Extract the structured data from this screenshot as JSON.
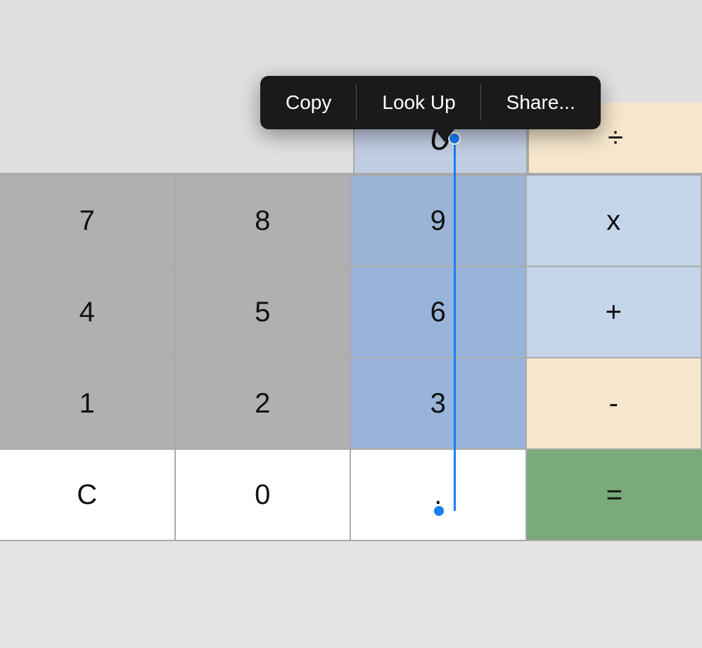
{
  "context_menu": {
    "items": [
      "Copy",
      "Look Up",
      "Share..."
    ]
  },
  "display": {
    "value": "0",
    "operator": "÷"
  },
  "calculator": {
    "rows": [
      [
        {
          "label": "7",
          "type": "gray"
        },
        {
          "label": "8",
          "type": "gray"
        },
        {
          "label": "9",
          "type": "blue-selected"
        },
        {
          "label": "x",
          "type": "blue-light"
        }
      ],
      [
        {
          "label": "4",
          "type": "gray"
        },
        {
          "label": "5",
          "type": "gray"
        },
        {
          "label": "6",
          "type": "blue-selected"
        },
        {
          "label": "+",
          "type": "blue-light"
        }
      ],
      [
        {
          "label": "1",
          "type": "gray"
        },
        {
          "label": "2",
          "type": "gray"
        },
        {
          "label": "3",
          "type": "blue-selected"
        },
        {
          "label": "-",
          "type": "operator"
        }
      ],
      [
        {
          "label": "C",
          "type": "white"
        },
        {
          "label": "0",
          "type": "white"
        },
        {
          "label": ".",
          "type": "white"
        },
        {
          "label": "=",
          "type": "green"
        }
      ]
    ]
  }
}
